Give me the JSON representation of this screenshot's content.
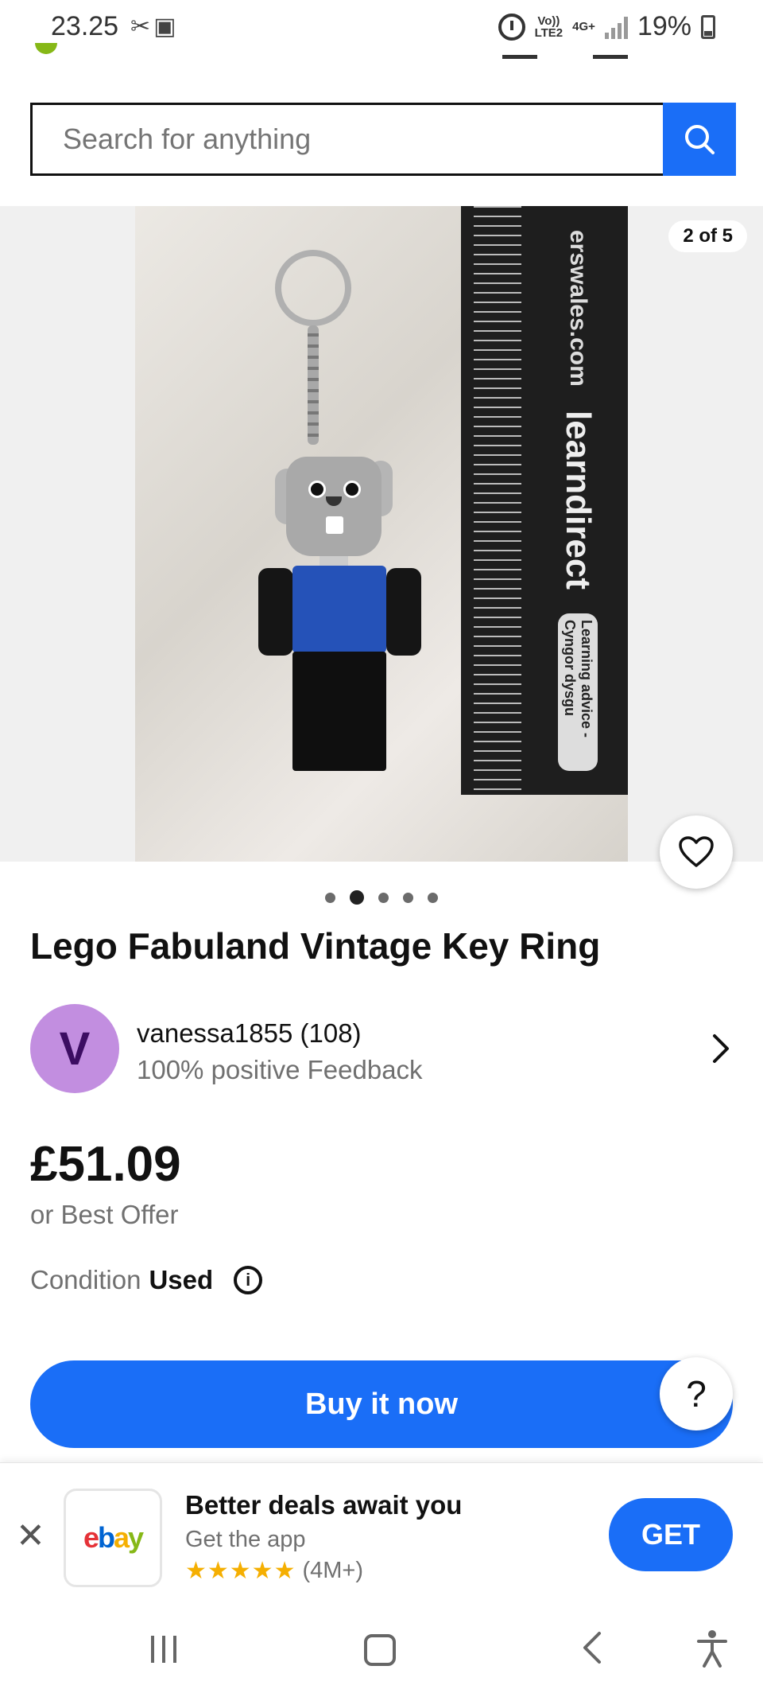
{
  "status_bar": {
    "time": "23.25",
    "battery": "19%",
    "volte_label": "Vo))\nLTE2",
    "network_label": "4G+"
  },
  "search": {
    "placeholder": "Search for anything",
    "icon": "search-icon"
  },
  "gallery": {
    "counter": "2 of 5",
    "page_count": 5,
    "active_index": 1,
    "photo_text": {
      "ruler_url": "erswales.com",
      "ruler_brand": "learndirect",
      "ruler_sub": "Learning advice - Cyngor dysgu"
    }
  },
  "listing": {
    "title": "Lego Fabuland Vintage Key Ring",
    "price": "£51.09",
    "best_offer": "or Best Offer",
    "condition_label": "Condition",
    "condition_value": "Used"
  },
  "seller": {
    "avatar_letter": "V",
    "name": "vanessa1855 (108)",
    "feedback": "100% positive Feedback"
  },
  "actions": {
    "buy_now": "Buy it now",
    "help": "?"
  },
  "app_banner": {
    "title": "Better deals await you",
    "subtitle": "Get the app",
    "stars": "★★★★★",
    "rating_count": "(4M+)",
    "get_label": "GET",
    "close": "✕"
  },
  "colors": {
    "accent_blue": "#1a6ef7",
    "avatar_bg": "#c28ee0",
    "star": "#f5af02"
  }
}
